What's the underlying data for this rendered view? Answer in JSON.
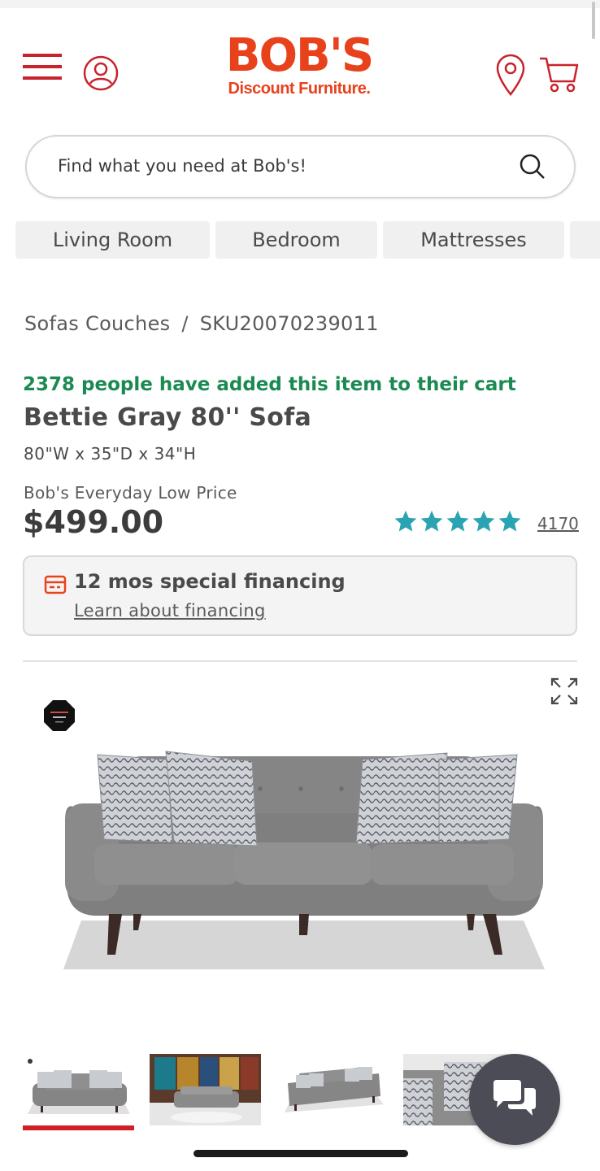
{
  "header": {
    "logo_main": "BOB'S",
    "logo_sub": "Discount Furniture.",
    "brand_color": "#e8421c",
    "icons": [
      "hamburger-menu-icon",
      "account-icon",
      "location-pin-icon",
      "cart-icon"
    ]
  },
  "search": {
    "placeholder": "Find what you need at Bob's!"
  },
  "categories": [
    {
      "label": "Living Room"
    },
    {
      "label": "Bedroom"
    },
    {
      "label": "Mattresses"
    }
  ],
  "breadcrumb": {
    "category": "Sofas Couches",
    "separator": "/",
    "sku": "SKU20070239011"
  },
  "product": {
    "social_proof": "2378 people have added this item to their cart",
    "social_color": "#1b8a52",
    "title": "Bettie Gray 80'' Sofa",
    "dimensions": "80\"W x 35\"D x 34\"H",
    "price_label": "Bob's Everyday Low Price",
    "price": "$499.00",
    "rating": 5,
    "star_color": "#2aa3b2",
    "review_count": "4170"
  },
  "financing": {
    "title": "12 mos special financing",
    "link": "Learn about financing",
    "accent": "#e8421c"
  },
  "gallery": {
    "thumbnail_count": 4,
    "active_index": 0,
    "active_color": "#d11f26"
  }
}
